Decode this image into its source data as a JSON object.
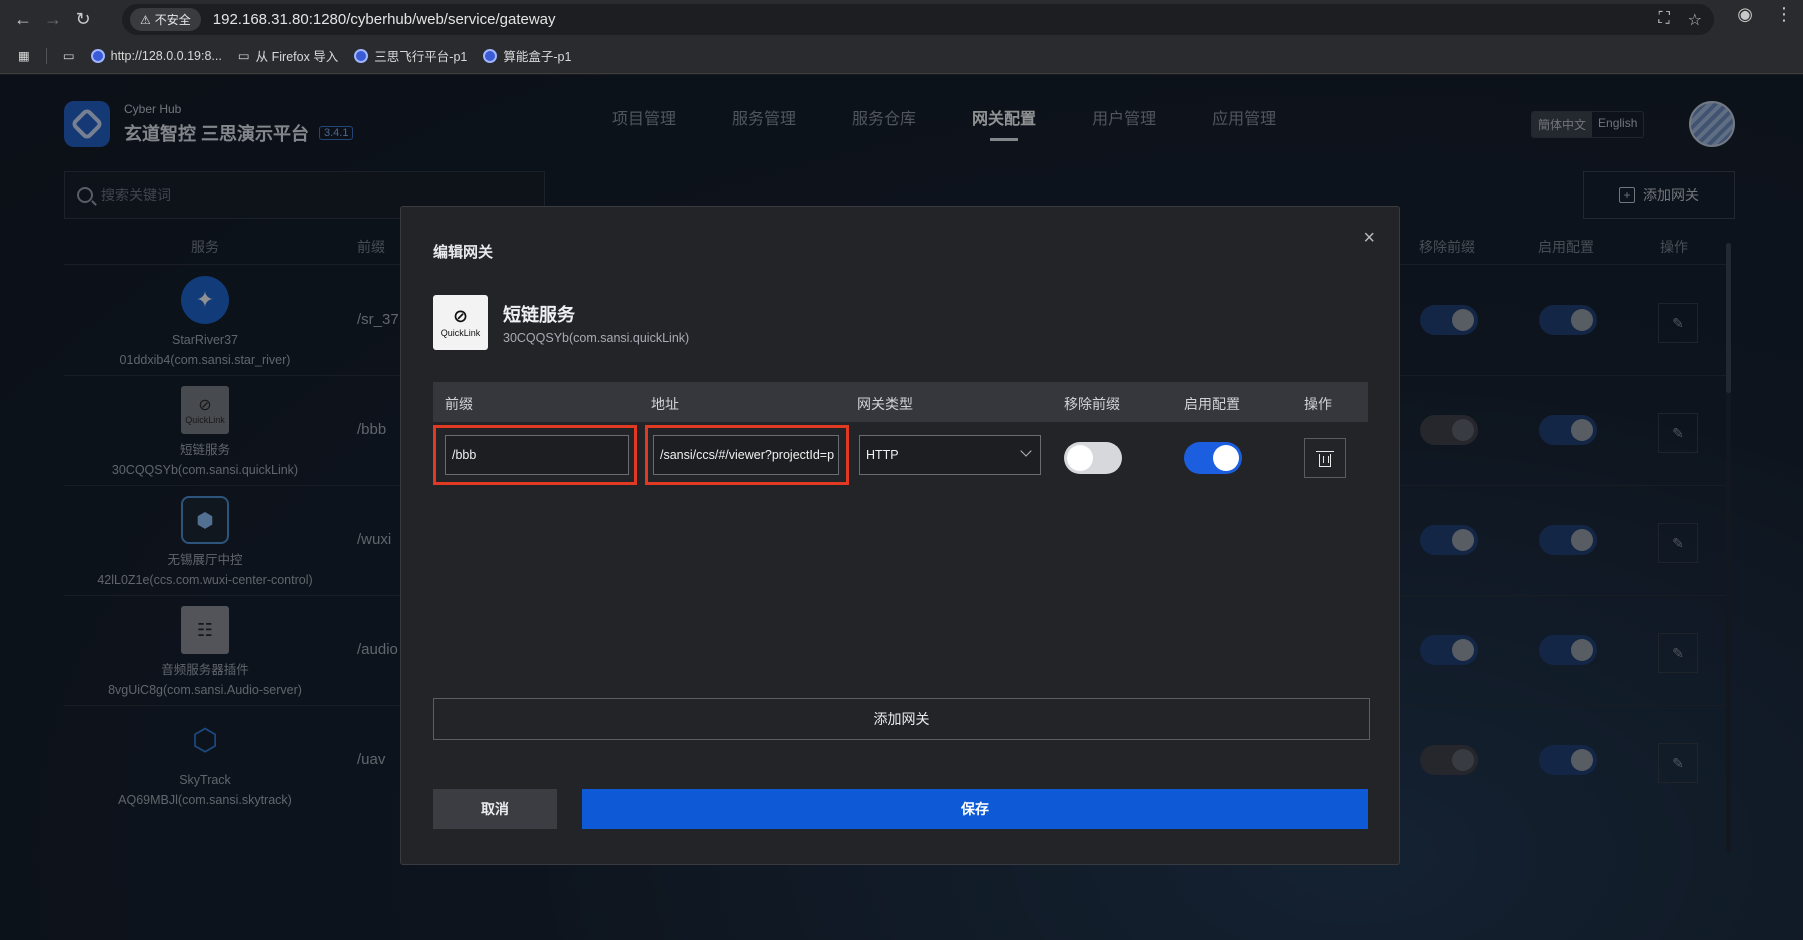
{
  "browser": {
    "url": "192.168.31.80:1280/cyberhub/web/service/gateway",
    "insecure_label": "不安全",
    "bookmarks": [
      {
        "label": "http://128.0.0.19:8..."
      },
      {
        "label": "从 Firefox 导入"
      },
      {
        "label": "三思飞行平台-p1"
      },
      {
        "label": "算能盒子-p1"
      }
    ]
  },
  "app": {
    "brand_small": "Cyber Hub",
    "brand_title": "玄道智控 三思演示平台",
    "version": "3.4.1",
    "nav": [
      "项目管理",
      "服务管理",
      "服务仓库",
      "网关配置",
      "用户管理",
      "应用管理"
    ],
    "active_nav": "网关配置",
    "lang": {
      "zh": "簡体中文",
      "en": "English"
    },
    "search_placeholder": "搜索关键词",
    "add_gateway": "添加网关",
    "columns": {
      "service": "服务",
      "prefix": "前缀",
      "remove_prefix": "移除前缀",
      "enable": "启用配置",
      "ops": "操作"
    },
    "rows": [
      {
        "name": "StarRiver37",
        "id": "01ddxib4(com.sansi.star_river)",
        "prefix": "/sr_37",
        "remove_prefix": true,
        "enabled": true
      },
      {
        "name": "短链服务",
        "id": "30CQQSYb(com.sansi.quickLink)",
        "prefix": "/bbb",
        "remove_prefix": false,
        "enabled": true
      },
      {
        "name": "无锡展厅中控",
        "id": "42lL0Z1e(ccs.com.wuxi-center-control)",
        "prefix": "/wuxi",
        "remove_prefix": true,
        "enabled": true
      },
      {
        "name": "音频服务器插件",
        "id": "8vgUiC8g(com.sansi.Audio-server)",
        "prefix": "/audio",
        "remove_prefix": true,
        "enabled": true
      },
      {
        "name": "SkyTrack",
        "id": "AQ69MBJl(com.sansi.skytrack)",
        "prefix": "/uav",
        "remove_prefix": false,
        "enabled": true
      }
    ],
    "quicklink_icon_text": "QuickLink"
  },
  "modal": {
    "title": "编辑网关",
    "close": "×",
    "service_name": "短链服务",
    "service_id": "30CQQSYb(com.sansi.quickLink)",
    "logo_text": "QuickLink",
    "columns": {
      "prefix": "前缀",
      "address": "地址",
      "type": "网关类型",
      "remove_prefix": "移除前缀",
      "enable": "启用配置",
      "ops": "操作"
    },
    "row": {
      "prefix": "/bbb",
      "address": "/sansi/ccs/#/viewer?projectId=p",
      "type": "HTTP",
      "remove_prefix": false,
      "enabled": true
    },
    "add_gateway": "添加网关",
    "cancel": "取消",
    "save": "保存"
  }
}
